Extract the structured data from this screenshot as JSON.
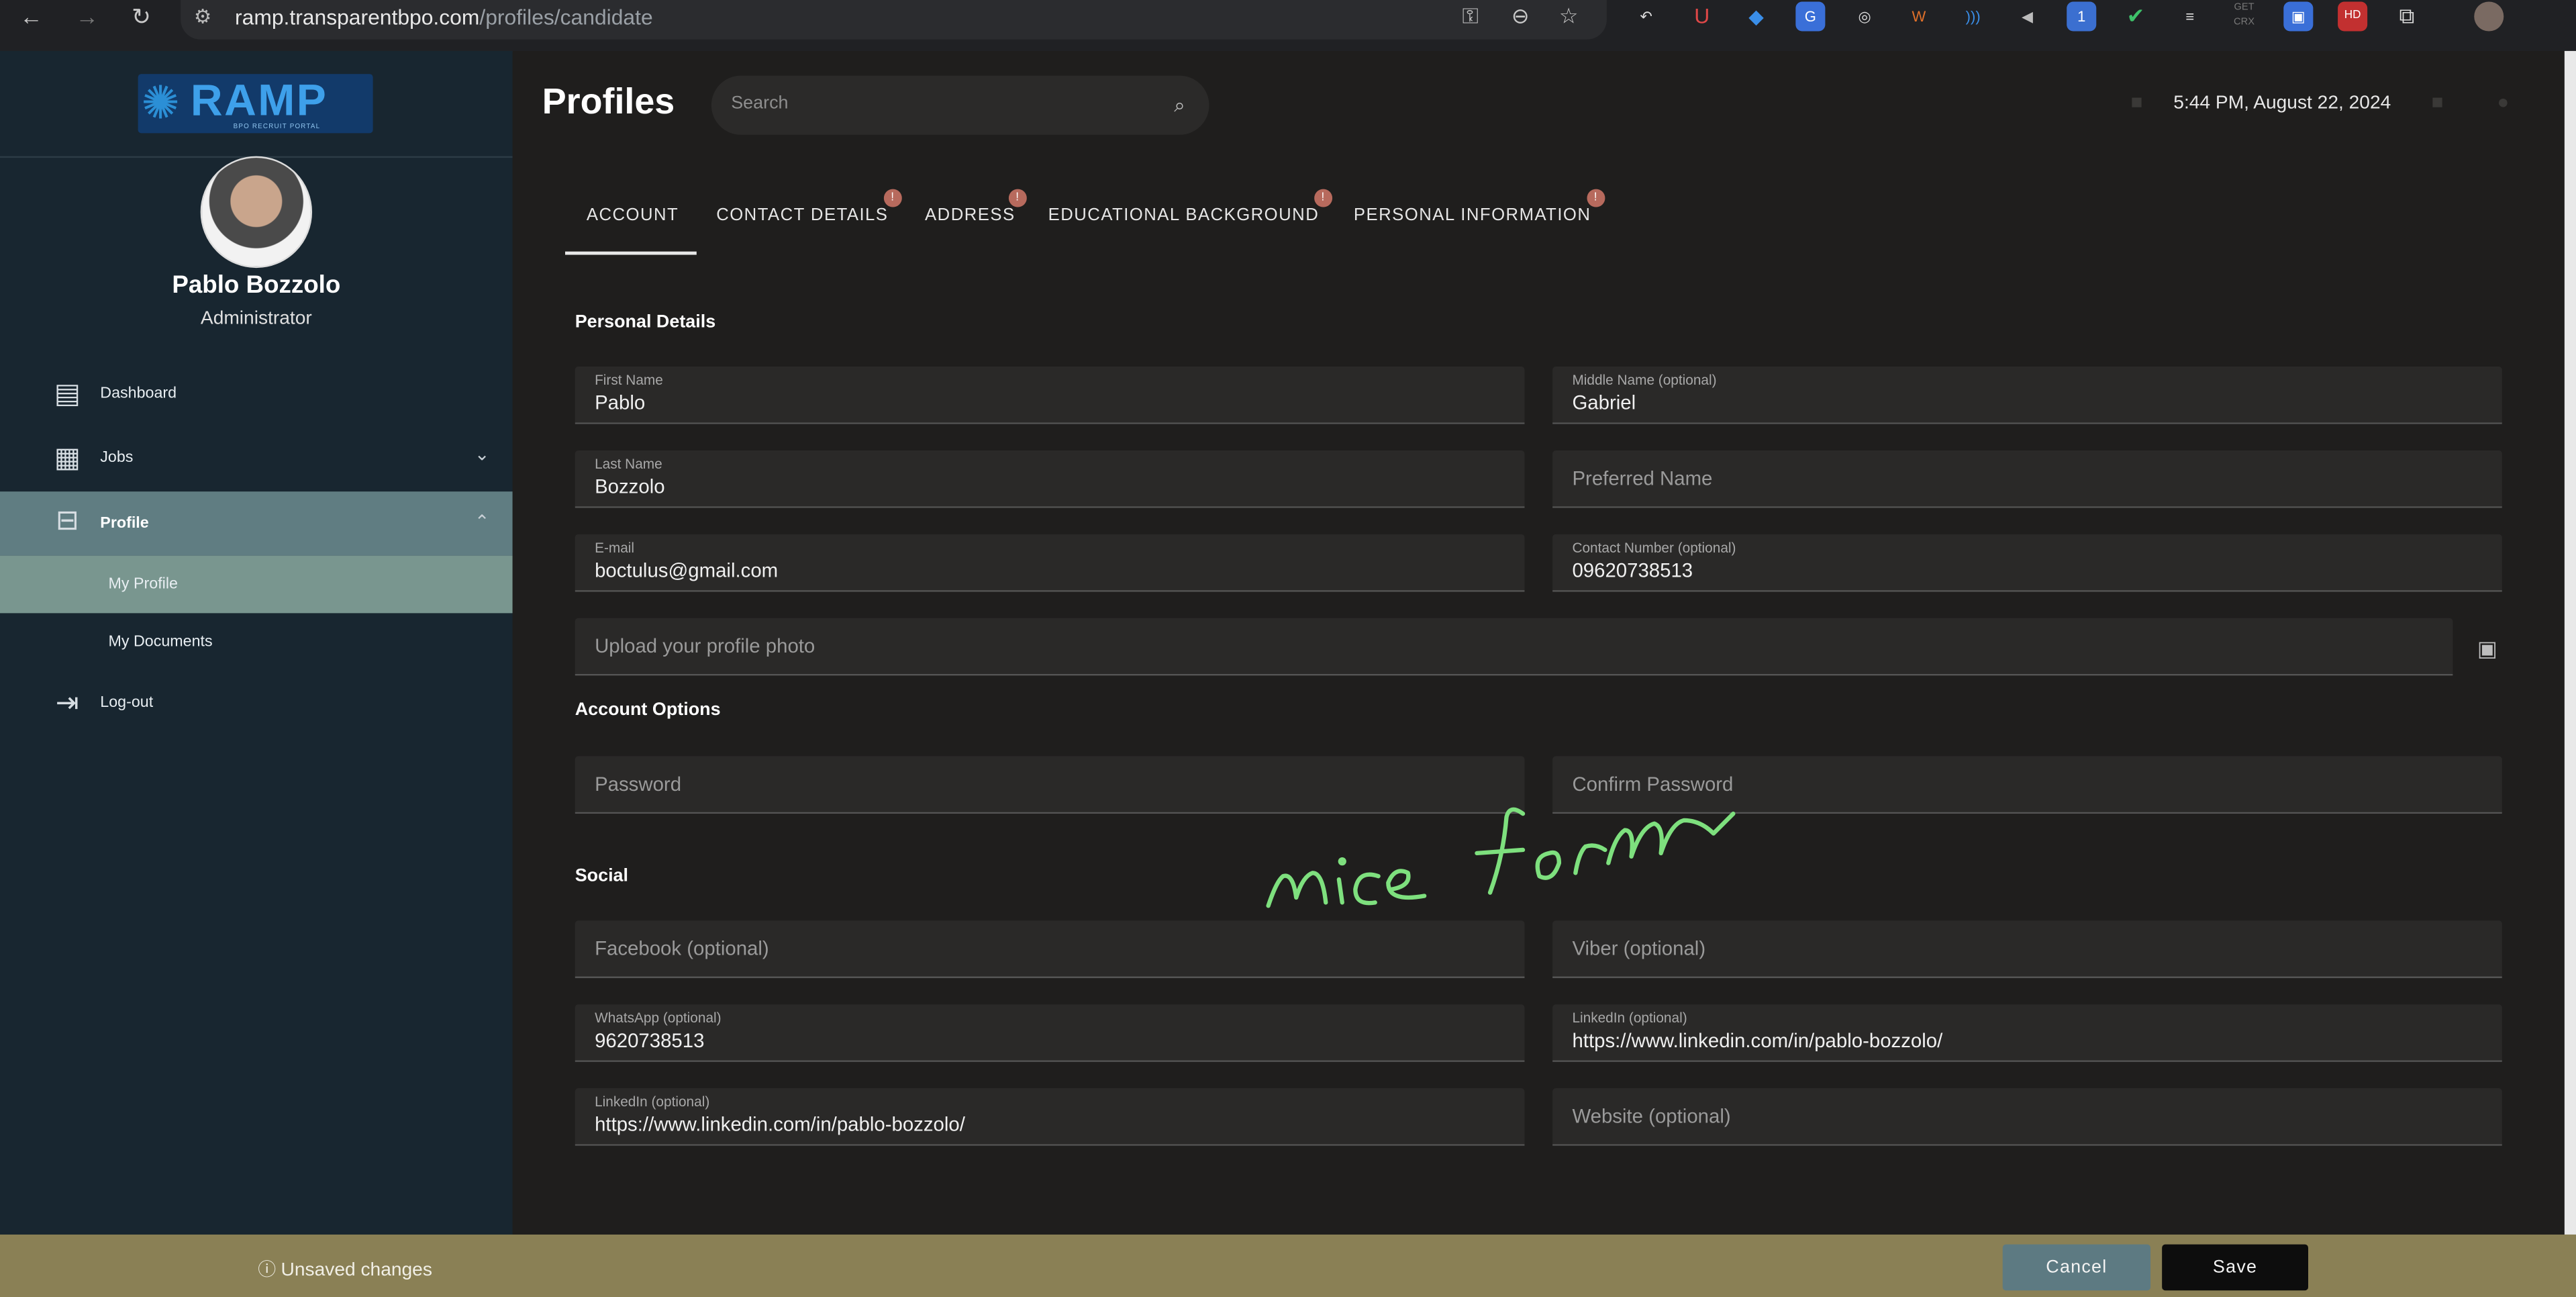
{
  "browser": {
    "url_host": "ramp.transparentbpo.com",
    "url_path": "/profiles/candidate"
  },
  "sidebar": {
    "logo_text": "RAMP",
    "logo_tagline": "BPO RECRUIT PORTAL",
    "user_name": "Pablo Bozzolo",
    "user_role": "Administrator",
    "items": [
      {
        "label": "Dashboard",
        "icon": "dashboard-icon"
      },
      {
        "label": "Jobs",
        "icon": "briefcase-icon"
      },
      {
        "label": "Profile",
        "icon": "profile-card-icon"
      },
      {
        "label": "My Profile"
      },
      {
        "label": "My Documents"
      },
      {
        "label": "Log-out",
        "icon": "logout-icon"
      }
    ]
  },
  "header": {
    "title": "Profiles",
    "search_placeholder": "Search",
    "datetime": "5:44 PM, August 22, 2024"
  },
  "tabs": [
    {
      "label": "ACCOUNT",
      "active": true
    },
    {
      "label": "CONTACT DETAILS",
      "badge": "!"
    },
    {
      "label": "ADDRESS",
      "badge": "!"
    },
    {
      "label": "EDUCATIONAL BACKGROUND",
      "badge": "!"
    },
    {
      "label": "PERSONAL INFORMATION",
      "badge": "!"
    }
  ],
  "form": {
    "personal_details_title": "Personal Details",
    "first_name": {
      "label": "First Name",
      "value": "Pablo"
    },
    "middle_name": {
      "label": "Middle Name (optional)",
      "value": "Gabriel"
    },
    "last_name": {
      "label": "Last Name",
      "value": "Bozzolo"
    },
    "preferred_name": {
      "placeholder": "Preferred Name"
    },
    "email": {
      "label": "E-mail",
      "value": "boctulus@gmail.com"
    },
    "contact_number": {
      "label": "Contact Number (optional)",
      "value": "09620738513"
    },
    "profile_photo": {
      "placeholder": "Upload your profile photo"
    },
    "account_options_title": "Account Options",
    "password": {
      "placeholder": "Password"
    },
    "confirm_password": {
      "placeholder": "Confirm Password"
    },
    "social_title": "Social",
    "facebook": {
      "placeholder": "Facebook (optional)"
    },
    "viber": {
      "placeholder": "Viber (optional)"
    },
    "whatsapp": {
      "label": "WhatsApp (optional)",
      "value": "9620738513"
    },
    "linkedin_right": {
      "label": "LinkedIn (optional)",
      "value": "https://www.linkedin.com/in/pablo-bozzolo/"
    },
    "linkedin_left": {
      "label": "LinkedIn (optional)",
      "value": "https://www.linkedin.com/in/pablo-bozzolo/"
    },
    "website": {
      "placeholder": "Website (optional)"
    }
  },
  "annotation": {
    "text": "nice form",
    "color": "#7ee07e"
  },
  "footer": {
    "unsaved_text": "Unsaved changes",
    "cancel_label": "Cancel",
    "save_label": "Save"
  },
  "colors": {
    "sidebar_bg": "#182630",
    "active_nav": "#607d82",
    "selected_sub": "#79968f",
    "footer_bg": "#8a8055",
    "badge": "#b76a5d"
  }
}
